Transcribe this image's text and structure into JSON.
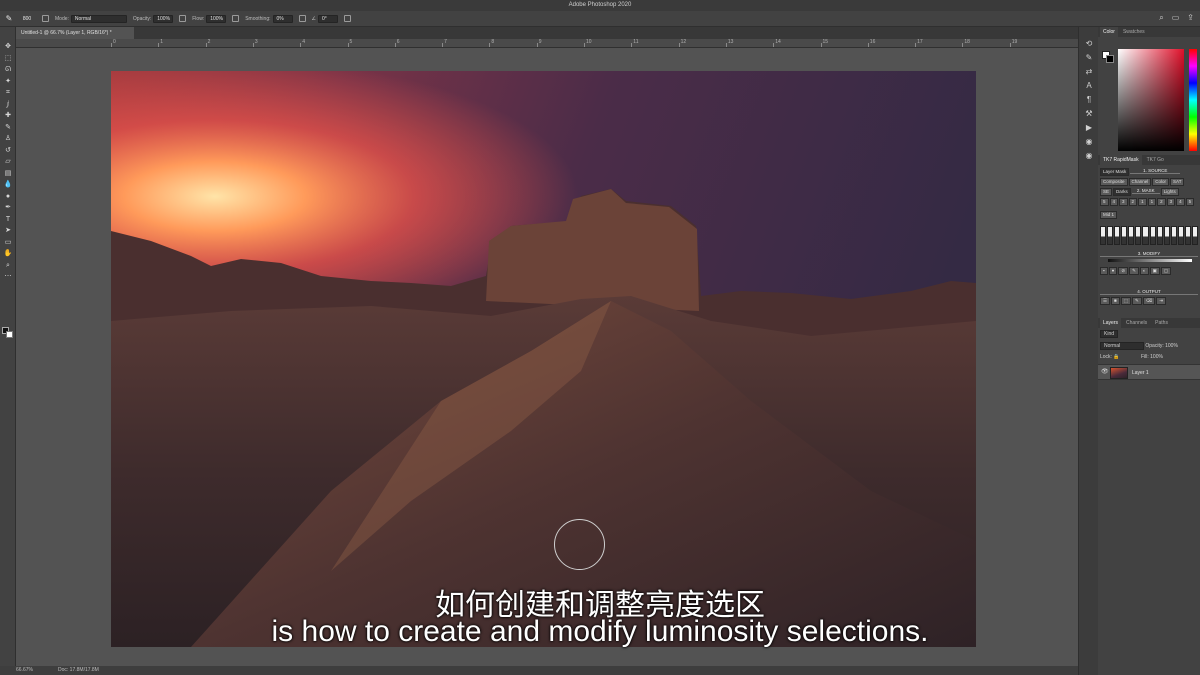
{
  "app": {
    "title": "Adobe Photoshop 2020"
  },
  "options_bar": {
    "mode_label": "Mode:",
    "mode_value": "Normal",
    "opacity_label": "Opacity:",
    "opacity_value": "100%",
    "flow_label": "Flow:",
    "flow_value": "100%",
    "smoothing_label": "Smoothing:",
    "smoothing_value": "0%",
    "angle_value": "0°",
    "brush_size": "800"
  },
  "document": {
    "tab_title": "Untitled-1 @ 66.7% (Layer 1, RGB/16*) *"
  },
  "status_bar": {
    "zoom": "66.67%",
    "doc": "Doc: 17.8M/17.8M"
  },
  "ruler": {
    "ticks": [
      "0",
      "1",
      "2",
      "3",
      "4",
      "5",
      "6",
      "7",
      "8",
      "9",
      "10",
      "11",
      "12",
      "13",
      "14",
      "15",
      "16",
      "17",
      "18",
      "19"
    ]
  },
  "color_panel": {
    "tabs": [
      "Color",
      "Swatches"
    ],
    "fg": "#ffffff",
    "bg": "#000000"
  },
  "rapidmask": {
    "tabs": [
      "TK7 RapidMask",
      "TK7 Go"
    ],
    "layer_mask": "Layer Mask",
    "source_title": "1. SOURCE",
    "source_buttons": [
      "Composite",
      "Channel",
      "Color",
      "SAT"
    ],
    "mask_title": "2. MASK",
    "mask_buttons": [
      "SE",
      "Darks",
      "Lights"
    ],
    "mask_numbers": [
      "5",
      "4",
      "3",
      "2",
      "1",
      "1",
      "2",
      "3",
      "4",
      "5"
    ],
    "midtones": "Mid 1",
    "modify_title": "3. MODIFY",
    "output_title": "4. OUTPUT"
  },
  "layers_panel": {
    "tabs": [
      "Layers",
      "Channels",
      "Paths"
    ],
    "kind": "Kind",
    "blend_mode": "Normal",
    "opacity_label": "Opacity:",
    "opacity_value": "100%",
    "lock_label": "Lock:",
    "fill_label": "Fill:",
    "fill_value": "100%",
    "layer_name": "Layer 1"
  },
  "subtitles": {
    "cn": "如何创建和调整亮度选区",
    "en": "is how to create and modify luminosity selections."
  }
}
